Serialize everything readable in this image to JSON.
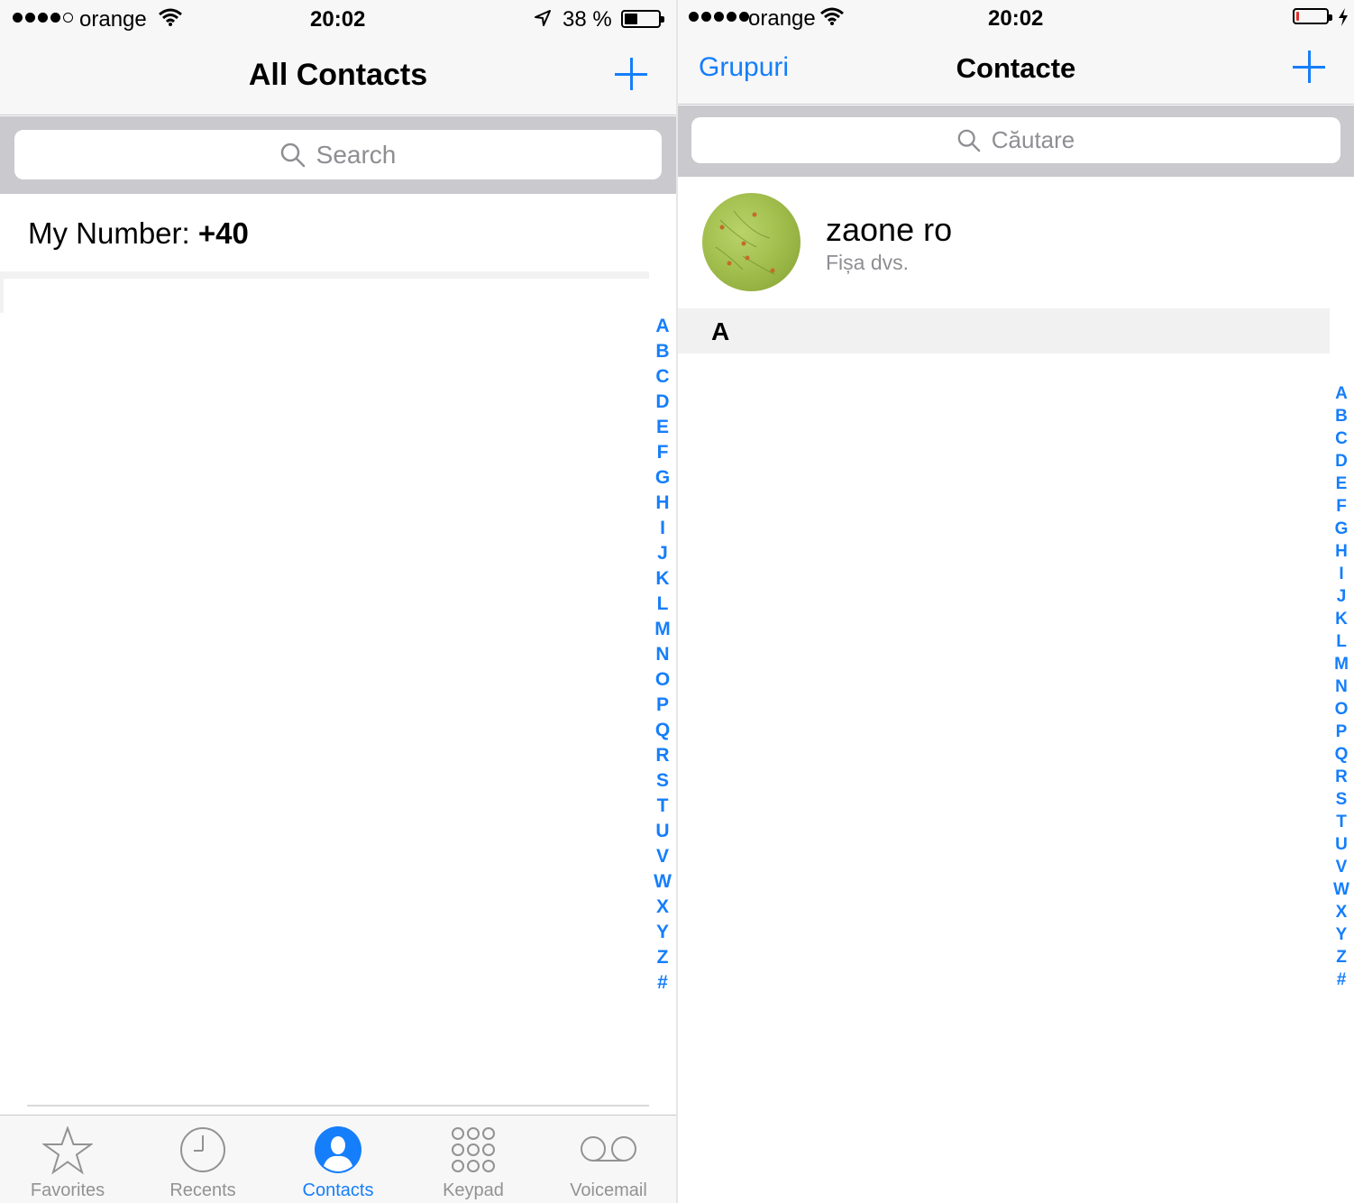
{
  "left": {
    "status": {
      "carrier": "orange",
      "signal_bars": 4,
      "time": "20:02",
      "battery_percent": "38 %",
      "battery_level": 0.38
    },
    "nav": {
      "title": "All Contacts",
      "add_icon": "plus-icon"
    },
    "search": {
      "placeholder": "Search"
    },
    "my_number": {
      "label": "My Number:",
      "value": "+40"
    },
    "index_letters": [
      "A",
      "B",
      "C",
      "D",
      "E",
      "F",
      "G",
      "H",
      "I",
      "J",
      "K",
      "L",
      "M",
      "N",
      "O",
      "P",
      "Q",
      "R",
      "S",
      "T",
      "U",
      "V",
      "W",
      "X",
      "Y",
      "Z",
      "#"
    ],
    "tabs": [
      {
        "label": "Favorites",
        "icon": "star-icon",
        "active": false
      },
      {
        "label": "Recents",
        "icon": "clock-icon",
        "active": false
      },
      {
        "label": "Contacts",
        "icon": "contacts-icon",
        "active": true
      },
      {
        "label": "Keypad",
        "icon": "keypad-icon",
        "active": false
      },
      {
        "label": "Voicemail",
        "icon": "voicemail-icon",
        "active": false
      }
    ]
  },
  "right": {
    "status": {
      "carrier": "orange",
      "signal_bars": 5,
      "time": "20:02",
      "charging": true
    },
    "nav": {
      "back_label": "Grupuri",
      "title": "Contacte",
      "add_icon": "plus-icon"
    },
    "search": {
      "placeholder": "Căutare"
    },
    "my_card": {
      "name": "zaone ro",
      "subtitle": "Fișa dvs."
    },
    "section_header": "A",
    "index_letters": [
      "A",
      "B",
      "C",
      "D",
      "E",
      "F",
      "G",
      "H",
      "I",
      "J",
      "K",
      "L",
      "M",
      "N",
      "O",
      "P",
      "Q",
      "R",
      "S",
      "T",
      "U",
      "V",
      "W",
      "X",
      "Y",
      "Z",
      "#"
    ]
  },
  "colors": {
    "accent": "#157efb",
    "inactive": "#929292",
    "search_bg": "#c9c9ce"
  }
}
